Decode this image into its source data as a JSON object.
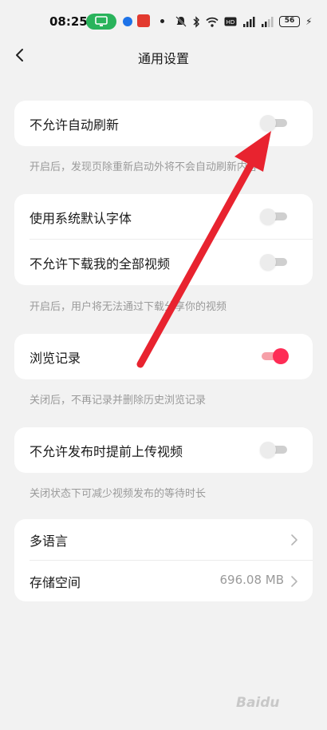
{
  "status_bar": {
    "time": "08:25",
    "battery": "56",
    "icons": [
      "cast-icon",
      "app-icon",
      "app-icon",
      "dot-icon",
      "mute-icon",
      "bluetooth-icon",
      "wifi-icon",
      "hd-icon",
      "signal-icon",
      "signal-icon",
      "battery-icon",
      "charging-icon"
    ]
  },
  "nav": {
    "title": "通用设置"
  },
  "sections": [
    {
      "rows": [
        {
          "label": "不允许自动刷新",
          "toggle_on": false
        }
      ],
      "hint": "开启后，发现页除重新启动外将不会自动刷新内容"
    },
    {
      "rows": [
        {
          "label": "使用系统默认字体",
          "toggle_on": false
        },
        {
          "label": "不允许下载我的全部视频",
          "toggle_on": false
        }
      ],
      "hint": "开启后，用户将无法通过下载分享你的视频"
    },
    {
      "rows": [
        {
          "label": "浏览记录",
          "toggle_on": true
        }
      ],
      "hint": "关闭后，不再记录并删除历史浏览记录"
    },
    {
      "rows": [
        {
          "label": "不允许发布时提前上传视频",
          "toggle_on": false
        }
      ],
      "hint": "关闭状态下可减少视频发布的等待时长"
    },
    {
      "rows": [
        {
          "label": "多语言",
          "value": ""
        },
        {
          "label": "存储空间",
          "value": "696.08 MB"
        }
      ]
    }
  ],
  "watermark": "Baidu",
  "colors": {
    "accent": "#fe2c55",
    "annotation_arrow": "#e8232f",
    "background": "#f2f2f2"
  }
}
